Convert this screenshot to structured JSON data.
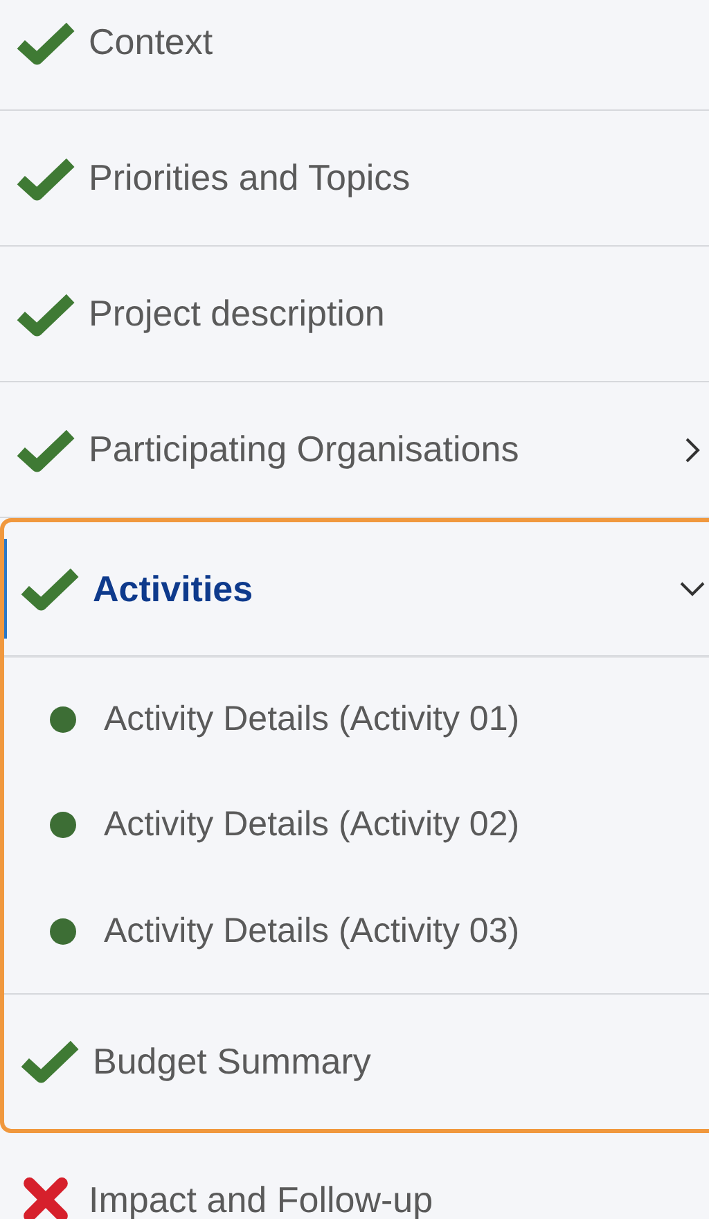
{
  "nav": [
    {
      "kind": "item",
      "label": "Context",
      "complete": true,
      "selected": false
    },
    {
      "kind": "item",
      "label": "Priorities and Topics",
      "complete": true,
      "selected": false
    },
    {
      "kind": "item",
      "label": "Project description",
      "complete": true,
      "selected": false
    },
    {
      "kind": "item",
      "label": "Participating Organisations",
      "complete": true,
      "expanded": false,
      "selected": false
    },
    {
      "kind": "group",
      "highlighted": true,
      "items": [
        {
          "kind": "item",
          "label": "Activities",
          "complete": true,
          "expanded": true,
          "selected": true,
          "children": [
            {
              "label": "Activity Details (Activity 01)",
              "color": "#3d6e35"
            },
            {
              "label": "Activity Details (Activity 02)",
              "color": "#3d6e35"
            },
            {
              "label": "Activity Details (Activity 03)",
              "color": "#3d6e35"
            }
          ]
        },
        {
          "kind": "item",
          "label": "Budget Summary",
          "complete": true,
          "selected": false
        }
      ]
    },
    {
      "kind": "item",
      "label": "Impact and Follow-up",
      "complete": false,
      "selected": false
    }
  ]
}
